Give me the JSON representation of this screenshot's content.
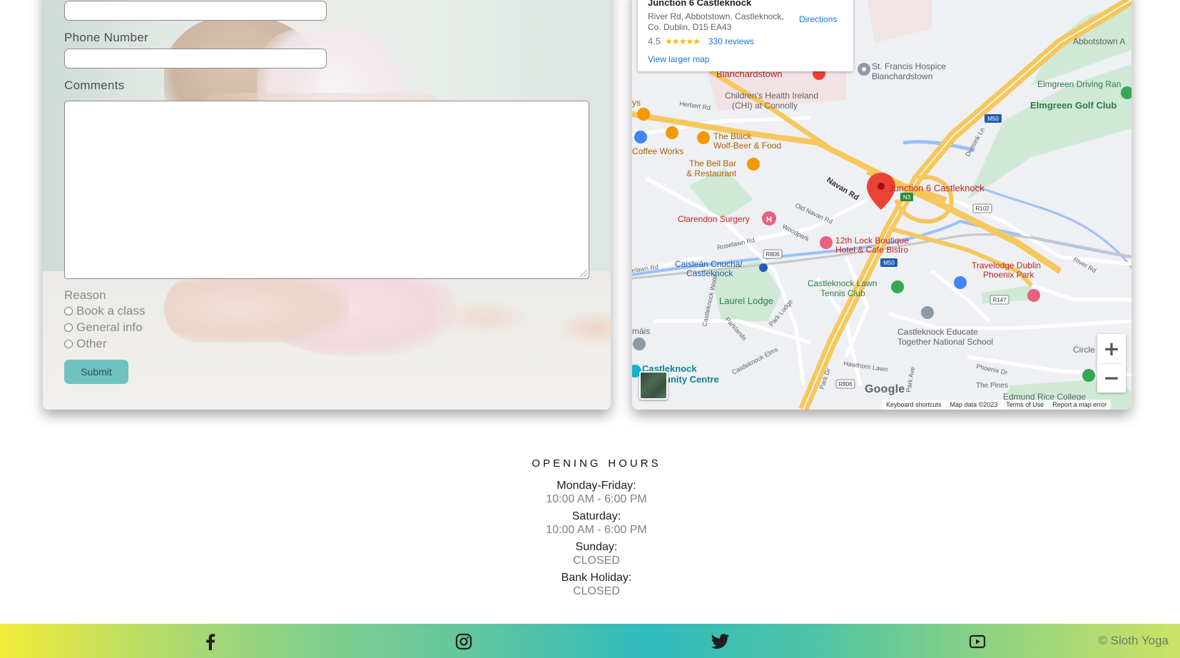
{
  "form": {
    "phone_label": "Phone Number",
    "comments_label": "Comments",
    "reason_label": "Reason",
    "reasons": [
      "Book a class",
      "General info",
      "Other"
    ],
    "submit_label": "Submit"
  },
  "map": {
    "place_name": "Junction 6 Castleknock",
    "address": "River Rd, Abbotstown, Castleknock, Co. Dublin, D15 EA43",
    "rating": "4.5",
    "stars": "★★★★★",
    "reviews": "330 reviews",
    "directions_label": "Directions",
    "larger_map_label": "View larger map",
    "labels": {
      "junction": "Junction 6 Castleknock",
      "blanchardstown": "Blanchardstown",
      "st_francis": "St. Francis Hospice Blanchardstown",
      "abbotstown": "Abbotstown A",
      "elmgreen_driving": "Elmgreen Driving Ran",
      "elmgreen_golf": "Elmgreen Golf Club",
      "childrens_health": "Children's Health Ireland (CHI) at Connolly",
      "herbert_rd": "Herbert Rd",
      "black_wolf": "The Black Wolf-Beer & Food",
      "coffee_works": "Coffee Works",
      "bell_bar": "The Bell Bar & Restaurant",
      "navan_rd": "Navan Rd",
      "old_navan_rd": "Old Navan Rd",
      "clarendon": "Clarendon Surgery",
      "woodpark": "Woodpark",
      "roselawn": "Roselawn Rd",
      "twelfth_lock": "12th Lock Boutique Hotel & Cafe Bistro",
      "caislean": "Caisleán Cnucha/ Castleknock",
      "elawn": "elawn Rd",
      "castleknock_lawn": "Castleknock Lawn Tennis Club",
      "travelodge": "Travelodge Dublin Phoenix Park",
      "river_rd": "River Rd",
      "laurel_lodge": "Laurel Lodge",
      "castleknock_wood": "Castleknock Wood",
      "parklands": "Parklands",
      "park_lodge": "Park Lodge",
      "castleknock_elms": "Castleknock Elms",
      "educate_together": "Castleknock Educate Together National School",
      "mais": "máis",
      "community_centre": "Castleknock Community Centre",
      "hawthorn": "Hawthorn Lawn",
      "park_dr": "Park Dr",
      "park_ave": "Park Ave",
      "the_pines": "The Pines",
      "phoenix_dr": "Phoenix Dr",
      "edmund_rice": "Edmund Rice College",
      "circle": "Circle",
      "dunsink": "Dunsink Ln",
      "m50_1": "M50",
      "m50_2": "M50",
      "n3": "N3",
      "r102": "R102",
      "r806_1": "R806",
      "r806_2": "R806",
      "r147": "R147",
      "ys": "ys"
    },
    "zoom_in": "+",
    "zoom_out": "−",
    "google_logo": "Google",
    "attribution": [
      "Keyboard shortcuts",
      "Map data ©2023",
      "Terms of Use",
      "Report a map error"
    ]
  },
  "hours": {
    "title": "Opening Hours",
    "entries": [
      {
        "day": "Monday-Friday:",
        "time": "10:00 AM - 6:00 PM"
      },
      {
        "day": "Saturday:",
        "time": "10:00 AM - 6:00 PM"
      },
      {
        "day": "Sunday:",
        "time": "CLOSED"
      },
      {
        "day": "Bank Holiday:",
        "time": "CLOSED"
      }
    ]
  },
  "footer": {
    "icons": [
      "facebook-icon",
      "instagram-icon",
      "twitter-icon",
      "youtube-icon"
    ],
    "copyright": "© Sloth Yoga"
  },
  "colors": {
    "submit_bg": "#6ec2c2",
    "footer_yellow": "#f3ec3a",
    "footer_teal": "#2fbcbd",
    "link_blue": "#1a73e8",
    "map_pin": "#ea4335",
    "motorway": "#f6c75d"
  }
}
